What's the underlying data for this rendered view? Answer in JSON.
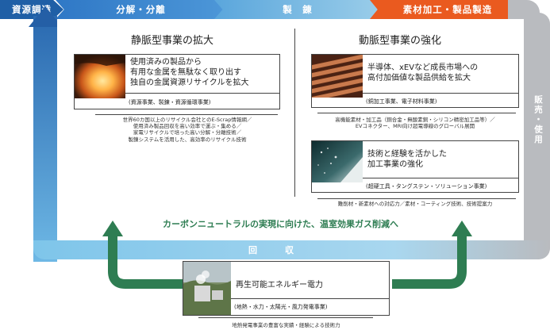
{
  "stages": [
    "資源調達",
    "分解・分離",
    "製　錬",
    "素材加工・製品製造"
  ],
  "side_label": "販売・使用",
  "bottom_band": "回　収",
  "left": {
    "title": "静脈型事業の拡大",
    "card": {
      "lines": [
        "使用済みの製品から",
        "有用な金属を無駄なく取り出す",
        "独自の金属資源リサイクルを拡大"
      ],
      "sub": "(資源事業、製錬・資源循環事業)"
    },
    "notes": [
      "世界60カ国以上のリサイクル会社とのE-Scrap情報網／",
      "使用済み製品回収を高い効率で運ぶ・集める／",
      "家電リサイクルで培った高い分解・分離技術／",
      "製錬システムを活用した、高効率のリサイクル技術"
    ]
  },
  "right": {
    "title": "動脈型事業の強化",
    "card1": {
      "lines": [
        "半導体、xEVなど成長市場への",
        "高付加価値な製品供給を拡大"
      ],
      "sub": "(銅加工事業、電子材料事業)"
    },
    "notes1": [
      "高機能素材・加工品（銅合金・無酸素銅・シリコン精密加工品等）／",
      "EVコネクター、MRI向け超電導線のグローバル展開"
    ],
    "card2": {
      "lines": [
        "技術と経験を活かした",
        "加工事業の強化"
      ],
      "sub": "(超硬工具・タングステン・ソリューション事業)"
    },
    "notes2": [
      "難削材・新素材への対応力／素材・コーティング技術、技術提案力"
    ]
  },
  "carbon_message": "カーボンニュートラルの実現に向けた、温室効果ガス削減へ",
  "bottom": {
    "title": "再生可能エネルギー電力",
    "sub": "(地熱・水力・太陽光・風力発電事業)",
    "note": "地熱発電事業の豊富な実績・経験による技術力"
  },
  "colors": {
    "stage1": "#1f5fa6",
    "stage4": "#ea5a1f",
    "carbon_green": "#2e7d52",
    "recover_band": "#7ec5ea",
    "sales_band": "#b9bbbf"
  }
}
